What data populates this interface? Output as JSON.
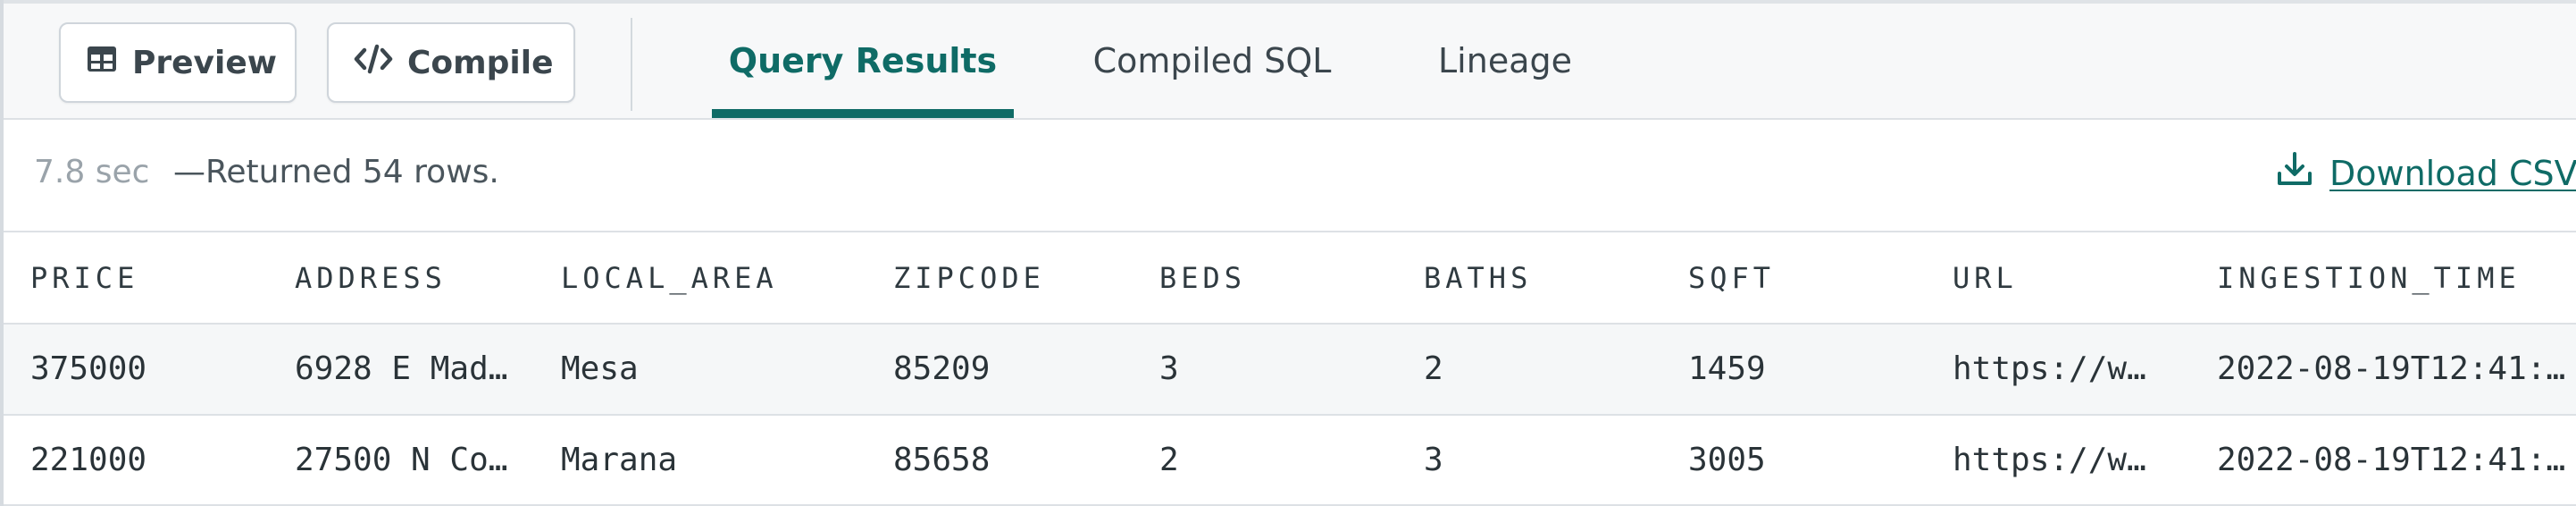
{
  "toolbar": {
    "preview_label": "Preview",
    "compile_label": "Compile",
    "tabs": [
      {
        "label": "Query Results",
        "active": true
      },
      {
        "label": "Compiled SQL",
        "active": false
      },
      {
        "label": "Lineage",
        "active": false
      }
    ]
  },
  "status": {
    "elapsed": "7.8 sec",
    "message": "—Returned 54 rows.",
    "download_label": "Download CSV"
  },
  "table": {
    "columns": [
      "PRICE",
      "ADDRESS",
      "LOCAL_AREA",
      "ZIPCODE",
      "BEDS",
      "BATHS",
      "SQFT",
      "URL",
      "INGESTION_TIME"
    ],
    "rows": [
      [
        "375000",
        "6928 E Mad…",
        "Mesa",
        "85209",
        "3",
        "2",
        "1459",
        "https://w…",
        "2022-08-19T12:41:…"
      ],
      [
        "221000",
        "27500 N Co…",
        "Marana",
        "85658",
        "2",
        "3",
        "3005",
        "https://w…",
        "2022-08-19T12:41:…"
      ]
    ]
  },
  "icons": {
    "preview": "table-icon",
    "compile": "code-icon",
    "download": "download-icon"
  },
  "colors": {
    "accent": "#0f6b66",
    "muted_text": "#9aa3aa",
    "border": "#dde1e5",
    "toolbar_bg": "#f7f8f9"
  }
}
